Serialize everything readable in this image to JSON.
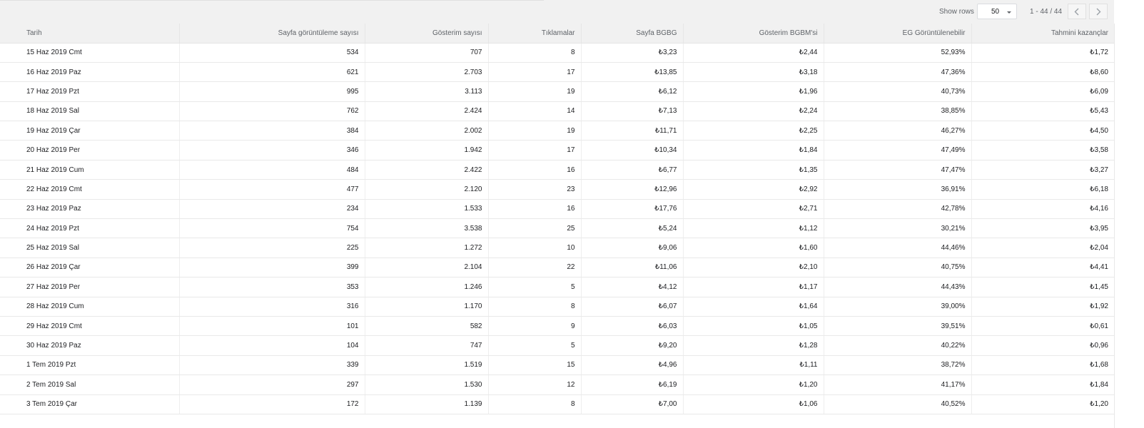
{
  "toolbar": {
    "show_rows_label": "Show rows",
    "rows_per_page": "50",
    "page_range": "1 - 44 / 44",
    "prev_icon": "chevron-left-icon",
    "next_icon": "chevron-right-icon"
  },
  "table": {
    "columns": [
      "Tarih",
      "Sayfa görüntüleme sayısı",
      "Gösterim sayısı",
      "Tıklamalar",
      "Sayfa BGBG",
      "Gösterim BGBM'si",
      "EG Görüntülenebilir",
      "Tahmini kazançlar"
    ],
    "rows": [
      [
        "15 Haz 2019 Cmt",
        "534",
        "707",
        "8",
        "₺3,23",
        "₺2,44",
        "52,93%",
        "₺1,72"
      ],
      [
        "16 Haz 2019 Paz",
        "621",
        "2.703",
        "17",
        "₺13,85",
        "₺3,18",
        "47,36%",
        "₺8,60"
      ],
      [
        "17 Haz 2019 Pzt",
        "995",
        "3.113",
        "19",
        "₺6,12",
        "₺1,96",
        "40,73%",
        "₺6,09"
      ],
      [
        "18 Haz 2019 Sal",
        "762",
        "2.424",
        "14",
        "₺7,13",
        "₺2,24",
        "38,85%",
        "₺5,43"
      ],
      [
        "19 Haz 2019 Çar",
        "384",
        "2.002",
        "19",
        "₺11,71",
        "₺2,25",
        "46,27%",
        "₺4,50"
      ],
      [
        "20 Haz 2019 Per",
        "346",
        "1.942",
        "17",
        "₺10,34",
        "₺1,84",
        "47,49%",
        "₺3,58"
      ],
      [
        "21 Haz 2019 Cum",
        "484",
        "2.422",
        "16",
        "₺6,77",
        "₺1,35",
        "47,47%",
        "₺3,27"
      ],
      [
        "22 Haz 2019 Cmt",
        "477",
        "2.120",
        "23",
        "₺12,96",
        "₺2,92",
        "36,91%",
        "₺6,18"
      ],
      [
        "23 Haz 2019 Paz",
        "234",
        "1.533",
        "16",
        "₺17,76",
        "₺2,71",
        "42,78%",
        "₺4,16"
      ],
      [
        "24 Haz 2019 Pzt",
        "754",
        "3.538",
        "25",
        "₺5,24",
        "₺1,12",
        "30,21%",
        "₺3,95"
      ],
      [
        "25 Haz 2019 Sal",
        "225",
        "1.272",
        "10",
        "₺9,06",
        "₺1,60",
        "44,46%",
        "₺2,04"
      ],
      [
        "26 Haz 2019 Çar",
        "399",
        "2.104",
        "22",
        "₺11,06",
        "₺2,10",
        "40,75%",
        "₺4,41"
      ],
      [
        "27 Haz 2019 Per",
        "353",
        "1.246",
        "5",
        "₺4,12",
        "₺1,17",
        "44,43%",
        "₺1,45"
      ],
      [
        "28 Haz 2019 Cum",
        "316",
        "1.170",
        "8",
        "₺6,07",
        "₺1,64",
        "39,00%",
        "₺1,92"
      ],
      [
        "29 Haz 2019 Cmt",
        "101",
        "582",
        "9",
        "₺6,03",
        "₺1,05",
        "39,51%",
        "₺0,61"
      ],
      [
        "30 Haz 2019 Paz",
        "104",
        "747",
        "5",
        "₺9,20",
        "₺1,28",
        "40,22%",
        "₺0,96"
      ],
      [
        "1 Tem 2019 Pzt",
        "339",
        "1.519",
        "15",
        "₺4,96",
        "₺1,11",
        "38,72%",
        "₺1,68"
      ],
      [
        "2 Tem 2019 Sal",
        "297",
        "1.530",
        "12",
        "₺6,19",
        "₺1,20",
        "41,17%",
        "₺1,84"
      ],
      [
        "3 Tem 2019 Çar",
        "172",
        "1.139",
        "8",
        "₺7,00",
        "₺1,06",
        "40,52%",
        "₺1,20"
      ]
    ]
  }
}
